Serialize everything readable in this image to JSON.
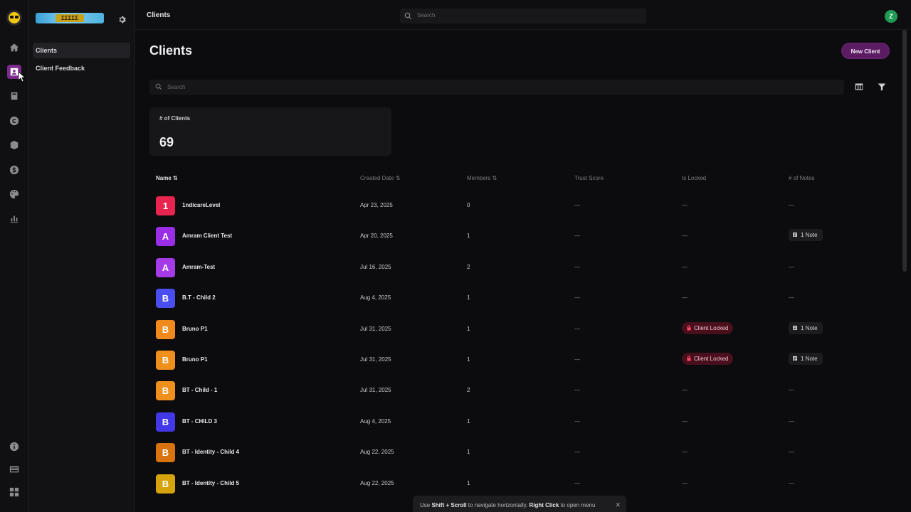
{
  "topbar": {
    "title": "Clients",
    "search_placeholder": "Search",
    "avatar_initial": "Z"
  },
  "sidebar": {
    "brand_text": "ΣΣΣΣΣ",
    "items": [
      {
        "label": "Clients",
        "active": true
      },
      {
        "label": "Client Feedback",
        "active": false
      }
    ]
  },
  "rail": {
    "icons": [
      "home-icon",
      "clients-icon",
      "docs-icon",
      "copyright-icon",
      "box-icon",
      "currency-icon",
      "palette-icon",
      "bar-chart-icon",
      "info-icon",
      "card-icon",
      "apps-icon"
    ]
  },
  "main": {
    "title": "Clients",
    "new_client_label": "New Client",
    "search_placeholder": "Search",
    "stat": {
      "label": "# of Clients",
      "value": "69"
    },
    "columns": {
      "name": "Name",
      "created": "Created Date",
      "members": "Members",
      "trust": "Trust Score",
      "locked": "Is Locked",
      "notes": "# of Notes"
    },
    "rows": [
      {
        "initial": "1",
        "color": "#e8254f",
        "name": "1ndicareLevel",
        "created": "Apr 23, 2025",
        "members": "0",
        "trust": "—",
        "locked": "—",
        "notes": "—"
      },
      {
        "initial": "A",
        "color": "#9a2ee6",
        "name": "Amram Client Test",
        "created": "Apr 20, 2025",
        "members": "1",
        "trust": "—",
        "locked": "—",
        "notes": "1 Note"
      },
      {
        "initial": "A",
        "color": "#a43ae8",
        "name": "Amram-Test",
        "created": "Jul 16, 2025",
        "members": "2",
        "trust": "—",
        "locked": "—",
        "notes": "—"
      },
      {
        "initial": "B",
        "color": "#4a4df0",
        "name": "B.T - Child 2",
        "created": "Aug 4, 2025",
        "members": "1",
        "trust": "—",
        "locked": "—",
        "notes": "—"
      },
      {
        "initial": "B",
        "color": "#f08a1c",
        "name": "Bruno P1",
        "created": "Jul 31, 2025",
        "members": "1",
        "trust": "—",
        "locked": "Client Locked",
        "notes": "1 Note"
      },
      {
        "initial": "B",
        "color": "#f0901c",
        "name": "Bruno P1",
        "created": "Jul 31, 2025",
        "members": "1",
        "trust": "—",
        "locked": "Client Locked",
        "notes": "1 Note"
      },
      {
        "initial": "B",
        "color": "#f0901c",
        "name": "BT - Child - 1",
        "created": "Jul 31, 2025",
        "members": "2",
        "trust": "—",
        "locked": "—",
        "notes": "—"
      },
      {
        "initial": "B",
        "color": "#4338e8",
        "name": "BT - CHILD 3",
        "created": "Aug 4, 2025",
        "members": "1",
        "trust": "—",
        "locked": "—",
        "notes": "—"
      },
      {
        "initial": "B",
        "color": "#d9730f",
        "name": "BT - Identity - Child 4",
        "created": "Aug 22, 2025",
        "members": "1",
        "trust": "—",
        "locked": "—",
        "notes": "—"
      },
      {
        "initial": "B",
        "color": "#d6a30c",
        "name": "BT - Identity - Child 5",
        "created": "Aug 22, 2025",
        "members": "1",
        "trust": "—",
        "locked": "—",
        "notes": "—"
      }
    ]
  },
  "toast": {
    "pre": "Use ",
    "key1": "Shift + Scroll",
    "mid": " to navigate horizontally. ",
    "key2": "Right Click",
    "post": " to open menu"
  }
}
